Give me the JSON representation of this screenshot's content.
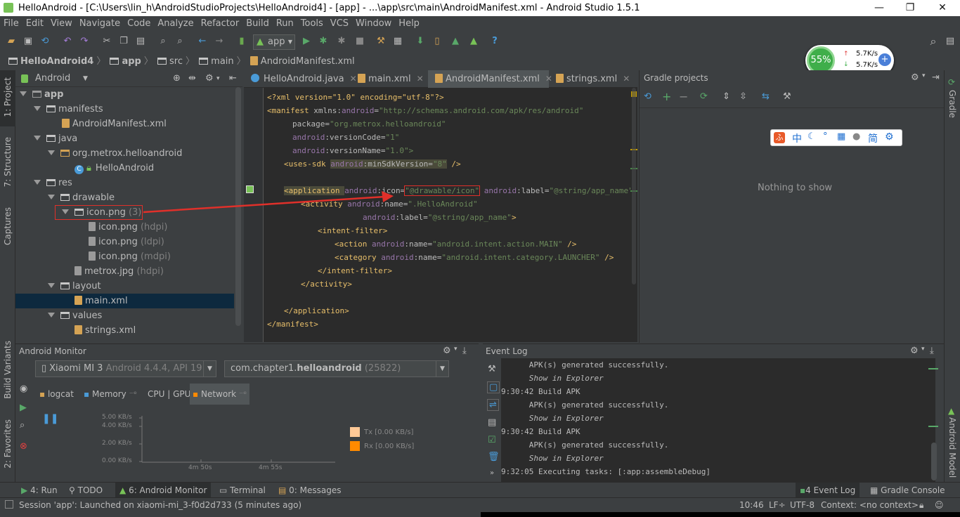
{
  "window": {
    "title": "HelloAndroid - [C:\\Users\\lin_h\\AndroidStudioProjects\\HelloAndroid4] - [app] - ...\\app\\src\\main\\AndroidManifest.xml - Android Studio 1.5.1",
    "minimize": "—",
    "restore": "❐",
    "close": "✕"
  },
  "menu": [
    "File",
    "Edit",
    "View",
    "Navigate",
    "Code",
    "Analyze",
    "Refactor",
    "Build",
    "Run",
    "Tools",
    "VCS",
    "Window",
    "Help"
  ],
  "toolbar": {
    "run_config": "app",
    "help": "?"
  },
  "breadcrumb": [
    "HelloAndroid4",
    "app",
    "src",
    "main",
    "AndroidManifest.xml"
  ],
  "net_widget": {
    "percent": "55%",
    "up": "5.7K/s",
    "down": "5.7K/s"
  },
  "project_panel": {
    "view": "Android",
    "tree": [
      {
        "label": "app",
        "extra": ""
      },
      {
        "label": "manifests",
        "extra": ""
      },
      {
        "label": "AndroidManifest.xml",
        "extra": ""
      },
      {
        "label": "java",
        "extra": ""
      },
      {
        "label": "org.metrox.helloandroid",
        "extra": ""
      },
      {
        "label": "HelloAndroid",
        "extra": ""
      },
      {
        "label": "res",
        "extra": ""
      },
      {
        "label": "drawable",
        "extra": ""
      },
      {
        "label": "icon.png",
        "extra": "(3)"
      },
      {
        "label": "icon.png",
        "extra": "(hdpi)"
      },
      {
        "label": "icon.png",
        "extra": "(ldpi)"
      },
      {
        "label": "icon.png",
        "extra": "(mdpi)"
      },
      {
        "label": "metrox.jpg",
        "extra": "(hdpi)"
      },
      {
        "label": "layout",
        "extra": ""
      },
      {
        "label": "main.xml",
        "extra": ""
      },
      {
        "label": "values",
        "extra": ""
      },
      {
        "label": "strings.xml",
        "extra": ""
      }
    ]
  },
  "side_tabs": {
    "project": "1: Project",
    "structure": "7: Structure",
    "captures": "Captures",
    "build_variants": "Build Variants",
    "favorites": "2: Favorites",
    "gradle": "Gradle",
    "android_model": "Android Model"
  },
  "editor_tabs": [
    "HelloAndroid.java",
    "main.xml",
    "AndroidManifest.xml",
    "strings.xml"
  ],
  "code": {
    "l1": "<?xml version=\"1.0\" encoding=\"utf-8\"?>",
    "l2a": "<manifest ",
    "l2b": "xmlns:",
    "l2c": "android",
    "l2d": "=",
    "l2e": "\"http://schemas.android.com/apk/res/android\"",
    "l3a": "package=",
    "l3b": "\"org.metrox.helloandroid\"",
    "l4a": "android",
    "l4b": ":versionCode=",
    "l4c": "\"1\"",
    "l5a": "android",
    "l5b": ":versionName=",
    "l5c": "\"1.0\">",
    "l6a": "<uses-sdk ",
    "l6b": "android",
    "l6c": ":minSdkVersion=",
    "l6d": "\"8\"",
    "l6e": " />",
    "l7a": "<application ",
    "l7b": "android",
    "l7c": ":icon=",
    "l7d": "\"@drawable/icon\"",
    "l7e": " android",
    "l7f": ":label=",
    "l7g": "\"@string/app_name\"",
    "l7h": ">",
    "l8a": "<activity ",
    "l8b": "android",
    "l8c": ":name=",
    "l8d": "\".HelloAndroid\"",
    "l9a": "android",
    "l9b": ":label=",
    "l9c": "\"@string/app_name\"",
    "l9d": ">",
    "l10": "<intent-filter>",
    "l11a": "<action ",
    "l11b": "android",
    "l11c": ":name=",
    "l11d": "\"android.intent.action.MAIN\"",
    "l11e": " />",
    "l12a": "<category ",
    "l12b": "android",
    "l12c": ":name=",
    "l12d": "\"android.intent.category.LAUNCHER\"",
    "l12e": " />",
    "l13": "</intent-filter>",
    "l14": "</activity>",
    "l15": "</application>",
    "l16": "</manifest>"
  },
  "gradle": {
    "title": "Gradle projects",
    "empty": "Nothing to show",
    "ime": [
      "中",
      "简"
    ]
  },
  "monitor": {
    "title": "Android Monitor",
    "device_name": "Xiaomi MI 3",
    "device_detail": " Android 4.4.4, API 19",
    "process_prefix": "com.chapter1.",
    "process_bold": "helloandroid",
    "process_pid": " (25822)",
    "tabs": [
      "logcat",
      "Memory",
      "CPU | GPU",
      "Network"
    ],
    "y_ticks": [
      "5.00 KB/s",
      "4.00 KB/s",
      "2.00 KB/s",
      "0.00 KB/s"
    ],
    "x_ticks": [
      "4m 50s",
      "4m 55s"
    ],
    "legend_tx": "Tx [0.00 KB/s]",
    "legend_rx": "Rx [0.00 KB/s]",
    "legend_tx_color": "#ffc997",
    "legend_rx_color": "#ff8a00"
  },
  "event_log": {
    "title": "Event Log",
    "lines": [
      "      APK(s) generated successfully.",
      "      Show in Explorer",
      "9:30:42 Build APK",
      "      APK(s) generated successfully.",
      "      Show in Explorer",
      "9:30:42 Build APK",
      "      APK(s) generated successfully.",
      "      Show in Explorer",
      "9:32:05 Executing tasks: [:app:assembleDebug]"
    ]
  },
  "bottom_tools": {
    "run": "4: Run",
    "todo": "TODO",
    "android_monitor": "6: Android Monitor",
    "terminal": "Terminal",
    "messages": "0: Messages",
    "event_log": "4 Event Log",
    "gradle_console": "Gradle Console"
  },
  "status": {
    "message": "Session 'app': Launched on xiaomi-mi_3-f0d2d733 (5 minutes ago)",
    "position": "10:46",
    "line_sep": "LF÷",
    "encoding": "UTF-8",
    "context": "Context: <no context>"
  }
}
